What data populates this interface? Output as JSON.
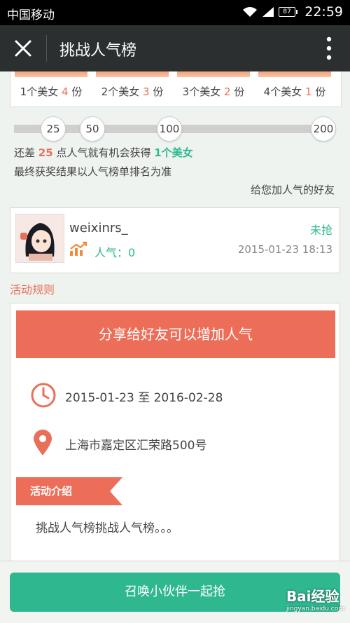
{
  "status_bar": {
    "carrier": "中国移动",
    "battery": "87",
    "time": "22:59"
  },
  "header": {
    "title": "挑战人气榜"
  },
  "prizes": [
    {
      "prefix": "1个美女",
      "count": "4",
      "unit": "份"
    },
    {
      "prefix": "2个美女",
      "count": "3",
      "unit": "份"
    },
    {
      "prefix": "3个美女",
      "count": "2",
      "unit": "份"
    },
    {
      "prefix": "4个美女",
      "count": "1",
      "unit": "份"
    }
  ],
  "progress": {
    "milestones": [
      "25",
      "50",
      "100",
      "200"
    ],
    "hint_prefix": "还差",
    "hint_points": "25",
    "hint_middle": "点人气就有机会获得",
    "hint_reward": "1个美女",
    "note": "最终获奖结果以人气榜单排名为准",
    "helpers_label": "给您加人气的好友"
  },
  "user": {
    "name": "weixinrs_",
    "status": "未抢",
    "popularity_label": "人气：0",
    "time": "2015-01-23 18:13"
  },
  "rules": {
    "title": "活动规则",
    "share_button": "分享给好友可以增加人气",
    "date_range": "2015-01-23 至 2016-02-28",
    "location": "上海市嘉定区汇荣路500号",
    "intro_tag": "活动介绍",
    "intro_text": "挑战人气榜挑战人气榜。。。"
  },
  "bottom": {
    "call_button": "召唤小伙伴一起抢",
    "watermark_brand": "Bai经验",
    "watermark_url": "jingyan.baidu.com"
  },
  "colors": {
    "accent_green": "#2fb890",
    "accent_red": "#ec6e58",
    "header_bg": "#2b2f2f"
  }
}
